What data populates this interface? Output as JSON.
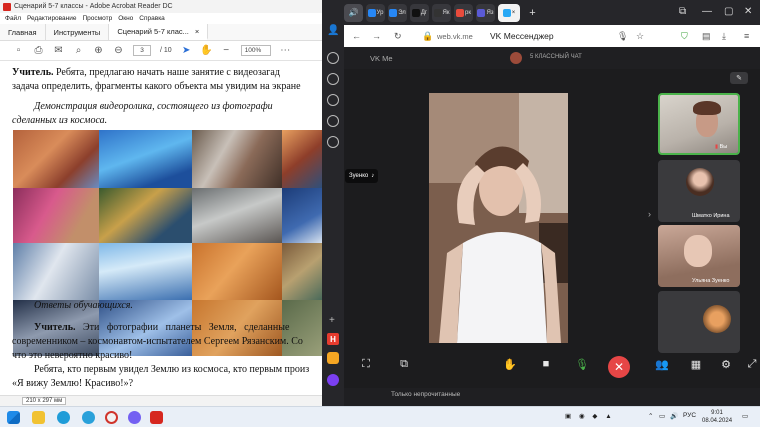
{
  "acrobat": {
    "title": "Сценарий 5-7 классы - Adobe Acrobat Reader DC",
    "menu": [
      "Файл",
      "Редактирование",
      "Просмотр",
      "Окно",
      "Справка"
    ],
    "tabs": [
      "Главная",
      "Инструменты",
      "Сценарий 5-7 клас..."
    ],
    "page_current": "3",
    "page_total": "/ 10",
    "zoom": "100%",
    "page_size": "210 x 297 мм",
    "doc": {
      "line1_bold": "Учитель.",
      "line1_rest": " Ребята, предлагаю начать наше занятие с видеозагад",
      "line2": "задача определить, фрагменты какого объекта мы увидим на экране",
      "line3": "Демонстрация видеоролика, состоящего из фотографи",
      "line4": "сделанных из космоса.",
      "line5": "Ответы обучающихся.",
      "line6_bold": "Учитель.",
      "line6_rest": " Эти фотографии планеты Земля, сделанные",
      "line7": "современником – космонавтом-испытателем Сергеем Рязанским. Со",
      "line8": "что это невероятно красиво!",
      "line9": "Ребята, кто первым увидел Землю из космоса, кто первым произ",
      "line10": "«Я вижу Землю! Красиво!»?"
    }
  },
  "browser": {
    "tabs": [
      {
        "label": "Ур",
        "color": "#2787f5"
      },
      {
        "label": "Эл",
        "color": "#2787f5"
      },
      {
        "label": "Дг",
        "color": "#222222"
      },
      {
        "label": "Як",
        "color": "#333333"
      },
      {
        "label": "рк",
        "color": "#e84b3c"
      },
      {
        "label": "Яз",
        "color": "#5a5ad6"
      }
    ],
    "url": "web.vk.me",
    "page_title": "VK Мессенджер",
    "vk_header": "VK Me",
    "chat_title": "5 КЛАССНЫЙ ЧАТ",
    "chat_filter": "Только непрочитанные",
    "speaker_label": "Зуенко",
    "participants": [
      {
        "name": "Вы"
      },
      {
        "name": "Шматко Ирина"
      },
      {
        "name": "Ульяна Зуенко"
      }
    ]
  },
  "taskbar": {
    "lang": "РУС",
    "time": "9:01",
    "date": "08.04.2024"
  },
  "colors": {
    "vk_blue": "#2787f5",
    "end_call": "#e64646",
    "active_speaker": "#4bb34b"
  }
}
